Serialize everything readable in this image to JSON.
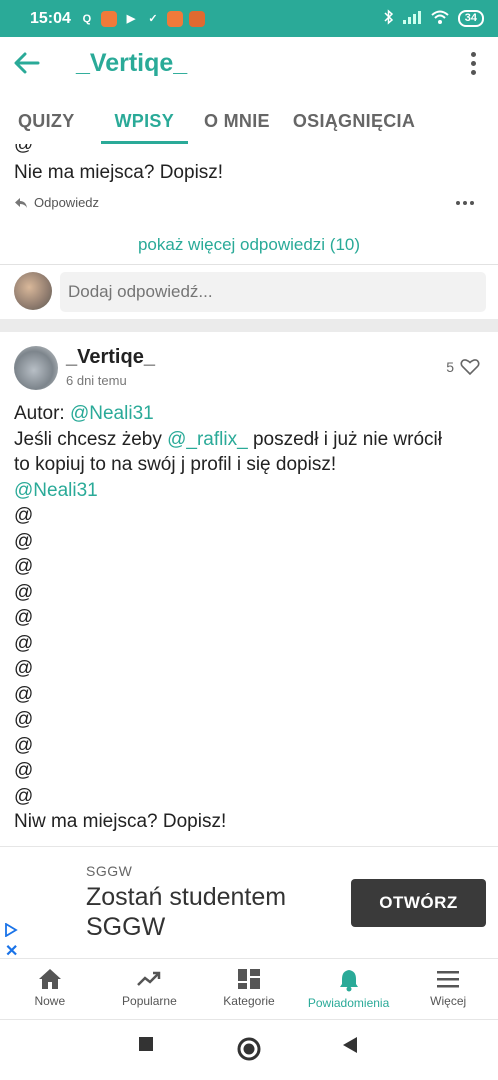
{
  "status_bar": {
    "time": "15:04",
    "battery": "34",
    "colors": {
      "background": "#2aaa98"
    }
  },
  "app_bar": {
    "title": "_Vertiqe_",
    "accent_color": "#2aaa98"
  },
  "tabs": [
    {
      "label": "QUIZY",
      "active": false
    },
    {
      "label": "WPISY",
      "active": true
    },
    {
      "label": "O MNIE",
      "active": false
    },
    {
      "label": "OSIĄGNIĘCIA",
      "active": false
    }
  ],
  "previous_reply": {
    "cropped_symbol": "@",
    "last_line": "Nie ma miejsca? Dopisz!",
    "reply_label": "Odpowiedz"
  },
  "show_more_replies": "pokaż więcej odpowiedzi (10)",
  "reply_input": {
    "placeholder": "Dodaj odpowiedź..."
  },
  "post": {
    "author": "_Vertiqe_",
    "time": "6 dni temu",
    "likes": "5",
    "author_label": "Autor:",
    "author_mention": "@Neali31",
    "line2_before": "Jeśli chcesz żeby",
    "line2_mention": "@_raflix_",
    "line2_after": "poszedł i już nie wrócił",
    "line3": "to kopiuj to na swój j profil i się dopisz!",
    "mention_line": "@Neali31",
    "at_lines": [
      "@",
      "@",
      "@",
      "@",
      "@",
      "@",
      "@",
      "@",
      "@",
      "@",
      "@",
      "@"
    ],
    "last_line": "Niw ma miejsca? Dopisz!"
  },
  "ad": {
    "brand": "SGGW",
    "headline": "Zostań studentem SGGW",
    "button": "OTWÓRZ"
  },
  "bottom_nav": [
    {
      "label": "Nowe",
      "icon": "home-icon",
      "active": false
    },
    {
      "label": "Popularne",
      "icon": "trending-icon",
      "active": false
    },
    {
      "label": "Kategorie",
      "icon": "grid-icon",
      "active": false
    },
    {
      "label": "Powiadomienia",
      "icon": "bell-icon",
      "active": true
    },
    {
      "label": "Więcej",
      "icon": "hamburger-icon",
      "active": false
    }
  ]
}
